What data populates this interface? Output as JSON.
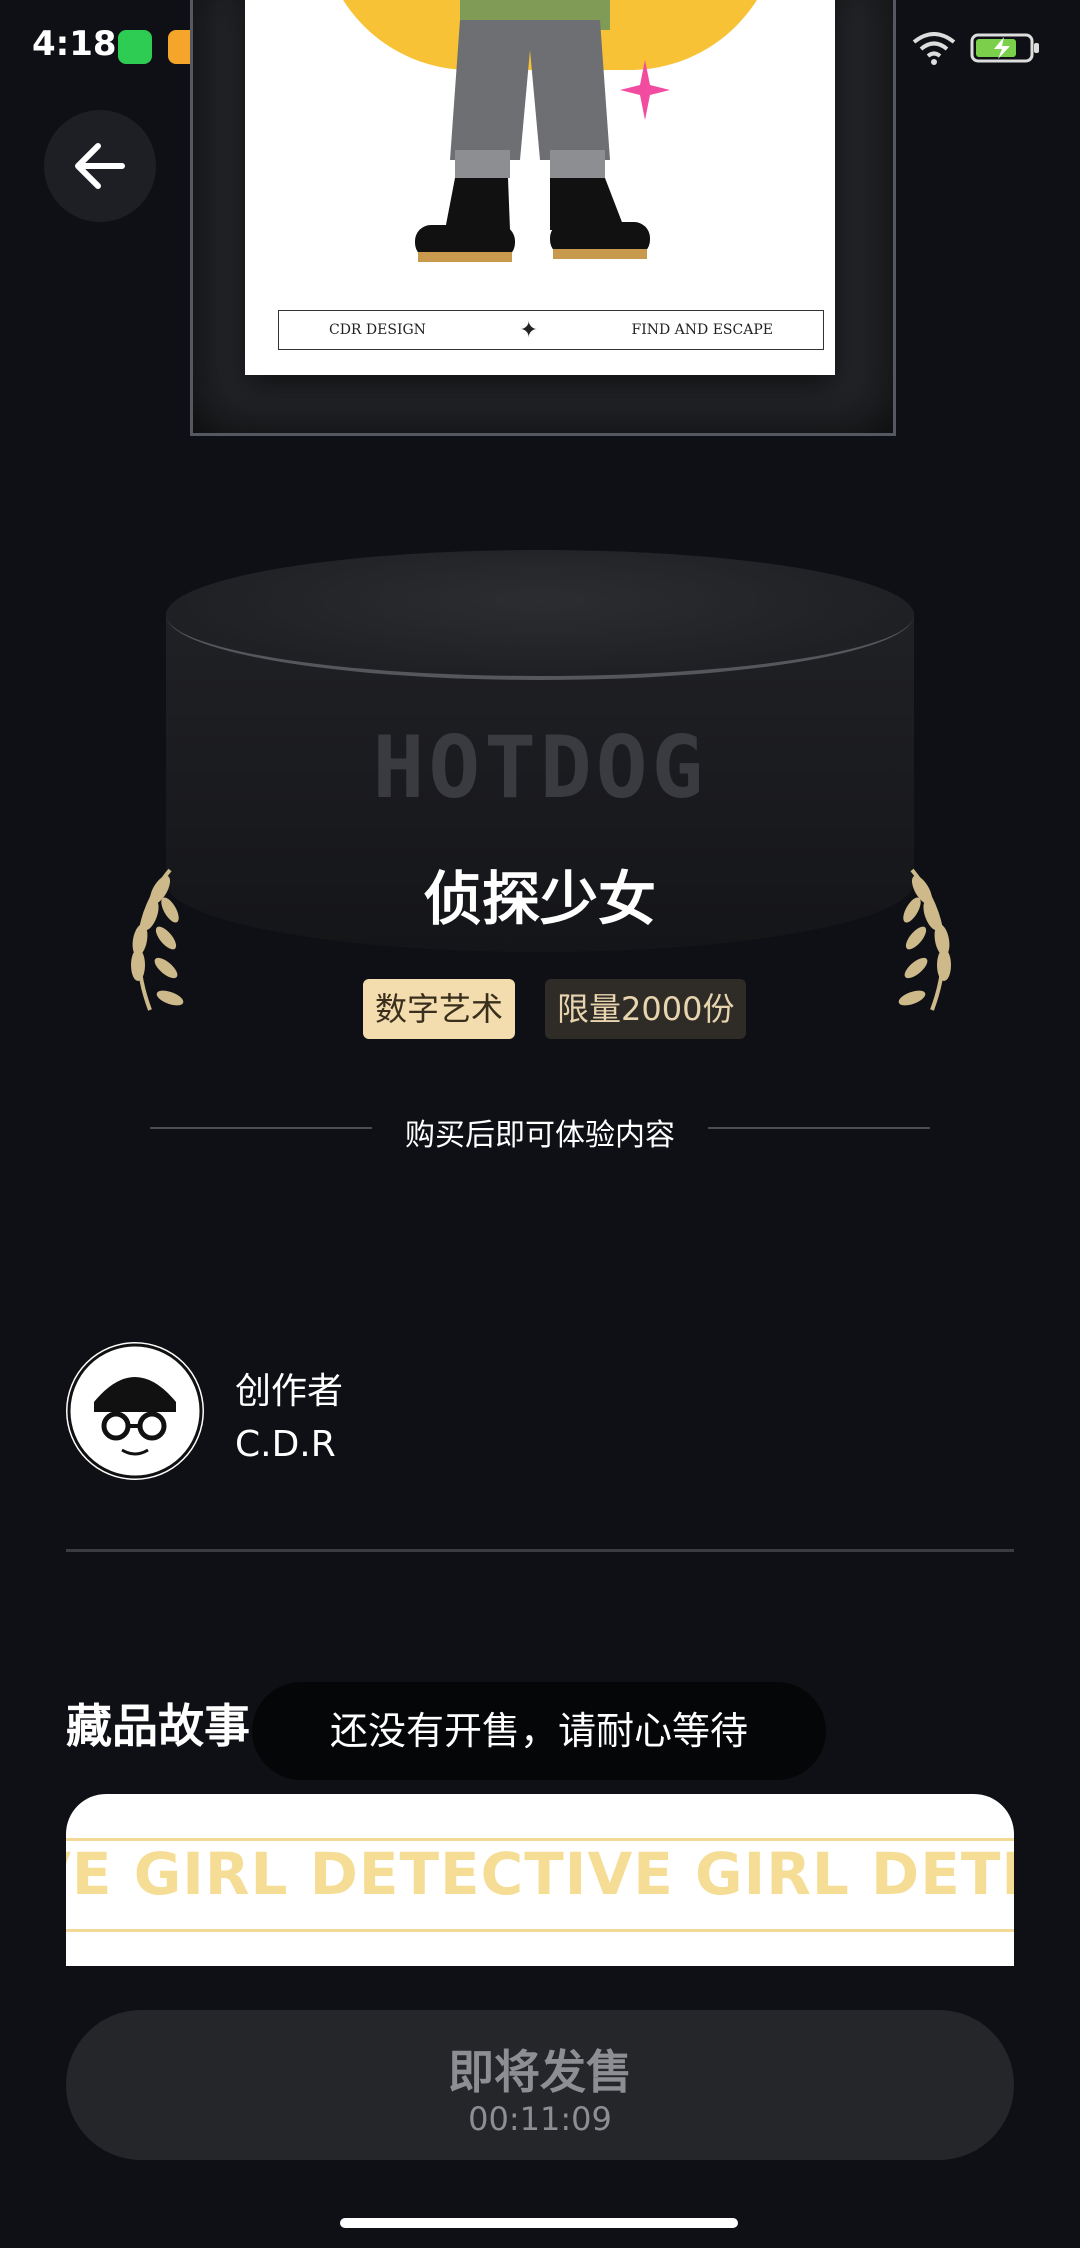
{
  "status_bar": {
    "time": "4:18"
  },
  "poster": {
    "footer_left": "CDR DESIGN",
    "footer_right": "FIND AND ESCAPE"
  },
  "pedestal": {
    "brand": "HOTDOG"
  },
  "item": {
    "title": "侦探少女",
    "tags": [
      "数字艺术",
      "限量2000份"
    ],
    "buy_note": "购买后即可体验内容"
  },
  "creator": {
    "role": "创作者",
    "name": "C.D.R"
  },
  "story": {
    "title": "藏品故事",
    "marquee": "VE GIRL  DETECTIVE GIRL  DETECTIVE"
  },
  "toast": {
    "message": "还没有开售，请耐心等待"
  },
  "sale_button": {
    "label": "即将发售",
    "countdown": "00:11:09"
  },
  "colors": {
    "background": "#0e1015",
    "tag_art_bg": "#f3dcae",
    "tag_limit_bg": "#2f2c28",
    "laurel": "#cdb98a"
  }
}
